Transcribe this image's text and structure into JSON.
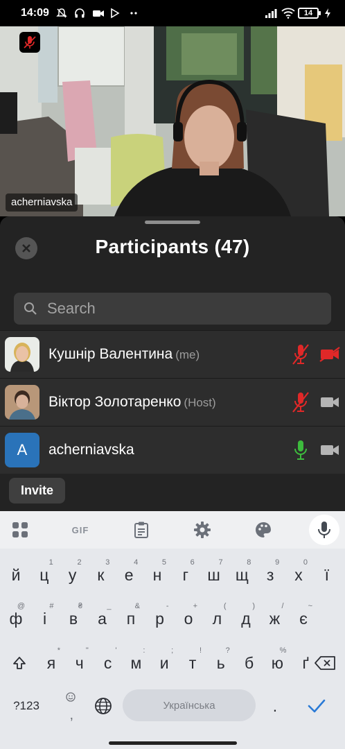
{
  "status_bar": {
    "time": "14:09",
    "battery": "14"
  },
  "video": {
    "participant_name": "acherniavska"
  },
  "participants_sheet": {
    "title": "Participants (47)",
    "search_placeholder": "Search",
    "participants": [
      {
        "name": "Кушнір Валентина",
        "role": "(me)",
        "mic": "muted",
        "camera": "off"
      },
      {
        "name": "Віктор Золотаренко",
        "role": "(Host)",
        "mic": "muted",
        "camera": "on"
      },
      {
        "name": "acherniavska",
        "role": "",
        "avatar_letter": "A",
        "mic": "active",
        "camera": "on"
      }
    ],
    "invite_label": "Invite"
  },
  "keyboard": {
    "toolbar": {
      "gif_label": "GIF",
      "icons": [
        "apps-grid-icon",
        "clipboard-icon",
        "settings-gear-icon",
        "palette-icon",
        "microphone-icon"
      ]
    },
    "row1": {
      "keys": [
        "й",
        "ц",
        "у",
        "к",
        "е",
        "н",
        "г",
        "ш",
        "щ",
        "з",
        "х",
        "ї"
      ],
      "hints": [
        "",
        "1",
        "2",
        "3",
        "4",
        "5",
        "6",
        "7",
        "8",
        "9",
        "0",
        ""
      ]
    },
    "row2": {
      "keys": [
        "ф",
        "і",
        "в",
        "а",
        "п",
        "р",
        "о",
        "л",
        "д",
        "ж",
        "є"
      ],
      "hints": [
        "@",
        "#",
        "₴",
        "_",
        "&",
        "-",
        "+",
        "(",
        ")",
        "/",
        "~"
      ]
    },
    "row3": {
      "keys": [
        "я",
        "ч",
        "с",
        "м",
        "и",
        "т",
        "ь",
        "б",
        "ю",
        "ґ"
      ],
      "hints": [
        "*",
        "\"",
        "'",
        ":",
        ";",
        "!",
        "?",
        "",
        "%",
        ""
      ]
    },
    "symbols_label": "?123",
    "emoji_hint": ",",
    "space_label": "Українська",
    "period_label": "."
  },
  "colors": {
    "sheet_bg": "#232323",
    "row_bg": "#2d2d2d",
    "muted_red": "#e02828",
    "active_green": "#3dbb3d",
    "avatar_blue": "#2a73b9"
  }
}
